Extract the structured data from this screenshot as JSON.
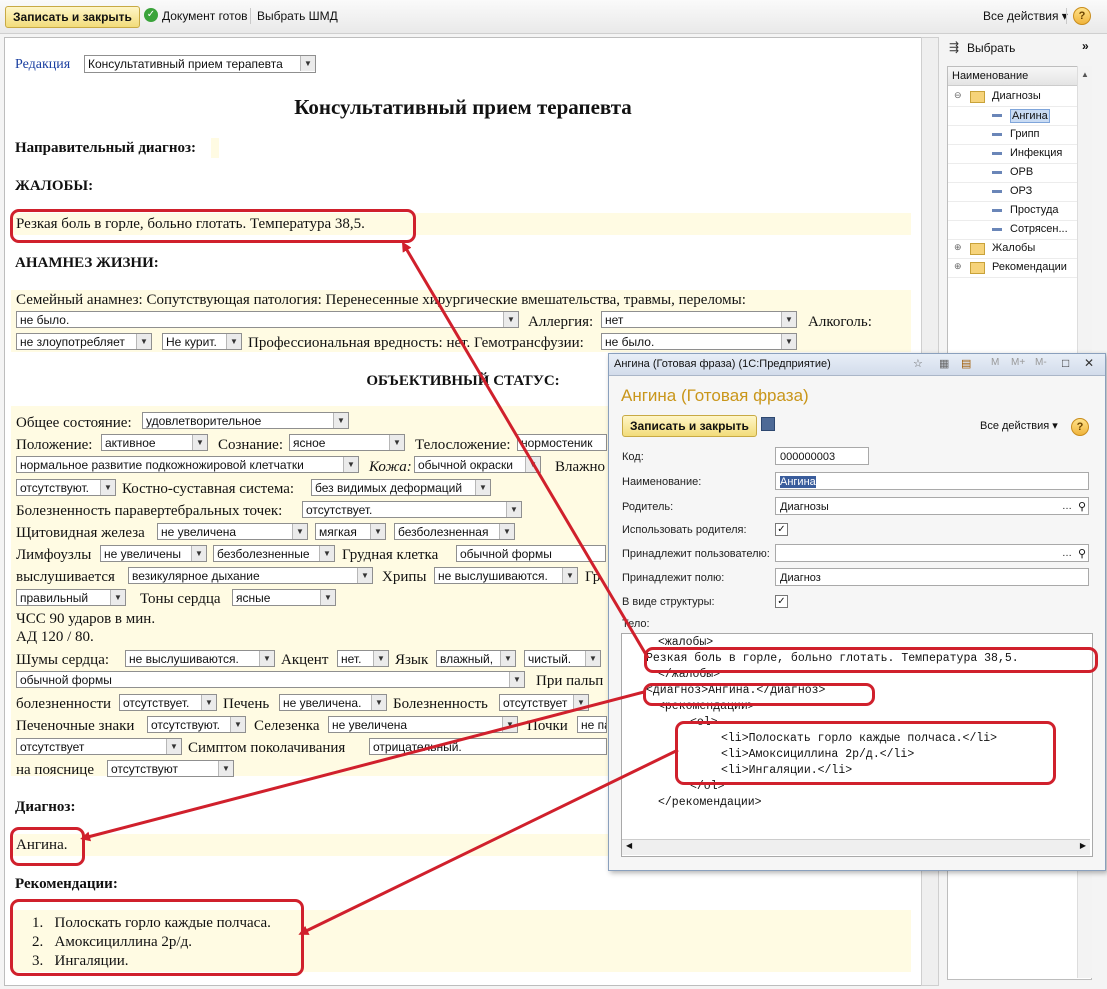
{
  "toolbar": {
    "save_close": "Записать и закрыть",
    "doc_ready": "Документ готов",
    "choose_template": "Выбрать ШМД",
    "all_actions": "Все действия",
    "help": "?"
  },
  "document": {
    "edition_label": "Редакция",
    "edition_value": "Консультативный прием терапевта",
    "title": "Консультативный прием терапевта",
    "referral_diagnosis": "Направительный диагноз:",
    "complaints_heading": "ЖАЛОБЫ:",
    "complaints_text": "Резкая боль в горле, больно глотать. Температура 38,5.",
    "anamnesis_heading": "АНАМНЕЗ ЖИЗНИ:",
    "anamnesis_line1": "Семейный анамнез:  Сопутствующая патология:   Перенесенные хирургические вмешательства, травмы, переломы:",
    "hist_value": "не было.",
    "allergy_label": "Аллергия:",
    "allergy_value": "нет",
    "alcohol_label": "Алкоголь:",
    "alcohol_value": "не злоупотребляет",
    "smoking_value": "Не курит.",
    "prof_label": "Профессиональная вредность: нет. Гемотрансфузии:",
    "transfusion_value": "не было.",
    "objective_heading": "ОБЪЕКТИВНЫЙ СТАТУС:",
    "general_label": "Общее состояние:",
    "general_value": "удовлетворительное",
    "position_label": "Положение:",
    "position_value": "активное",
    "consciousness_label": "Сознание:",
    "consciousness_value": "ясное",
    "build_label": "Телосложение:",
    "build_value": "нормостеник",
    "fat_value": "нормальное развитие подкожножировой клетчатки",
    "skin_label": "Кожа:",
    "skin_value": "обычной окраски",
    "moist_label": "Влажно",
    "absent_value": "отсутствуют.",
    "bones_label": "Костно-суставная система:",
    "bones_value": "без видимых деформаций",
    "paravert_label": "Болезненность паравертебральных точек:",
    "paravert_value": "отсутствует.",
    "thyroid_label": "Щитовидная железа",
    "thyroid_value1": "не увеличена",
    "thyroid_value2": "мягкая",
    "thyroid_value3": "безболезненная",
    "lymph_label": "Лимфоузлы",
    "lymph_value1": "не увеличены",
    "lymph_value2": "безболезненные",
    "chest_label": "Грудная клетка",
    "chest_value": "обычной формы",
    "auscult_label": "выслушивается",
    "breathing_value": "везикулярное дыхание",
    "rales_label": "Хрипы",
    "rales_value": "не выслушиваются.",
    "gr_label": "Гр",
    "rhythm_value": "правильный",
    "tones_label": "Тоны сердца",
    "tones_value": "ясные",
    "hr_text": "ЧСС 90 ударов в мин.",
    "bp_text": "АД 120 / 80.",
    "murmurs_label": "Шумы сердца:",
    "murmurs_value": "не выслушиваются.",
    "accent_label": "Акцент",
    "accent_value": "нет.",
    "tongue_label": "Язык",
    "tongue_value1": "влажный,",
    "tongue_value2": "чистый.",
    "belly_form_value": "обычной формы",
    "palp_label": "При пальп",
    "pain_label": "болезненности",
    "pain_value": "отсутствует.",
    "liver_label": "Печень",
    "liver_value": "не увеличена.",
    "pain2_label": "Болезненность",
    "pain2_value": "отсутствует",
    "liver_signs_label": "Печеночные знаки",
    "liver_signs_value": "отсутствуют.",
    "spleen_label": "Селезенка",
    "spleen_value": "не увеличена",
    "kidney_label": "Почки",
    "kidney_value": "не па",
    "tapping_pre_value": "отсутствует",
    "tapping_label": "Симптом поколачивания",
    "tapping_value": "отрицательный.",
    "lumbar_label": "на пояснице",
    "lumbar_value": "отсутствуют",
    "diagnosis_heading": "Диагноз:",
    "diagnosis_text": "Ангина.",
    "recommendations_heading": "Рекомендации:",
    "recommendations": [
      "Полоскать горло каждые полчаса.",
      "Амоксициллина 2р/д.",
      "Ингаляции."
    ]
  },
  "tree": {
    "choose": "Выбрать",
    "column": "Наименование",
    "items": [
      {
        "label": "Диагнозы",
        "level": 0,
        "icon": "folder-open"
      },
      {
        "label": "Ангина",
        "level": 1,
        "icon": "item",
        "selected": true
      },
      {
        "label": "Грипп",
        "level": 1,
        "icon": "item"
      },
      {
        "label": "Инфекция",
        "level": 1,
        "icon": "item"
      },
      {
        "label": "ОРВ",
        "level": 1,
        "icon": "item"
      },
      {
        "label": "ОРЗ",
        "level": 1,
        "icon": "item"
      },
      {
        "label": "Простуда",
        "level": 1,
        "icon": "item"
      },
      {
        "label": "Сотрясен...",
        "level": 1,
        "icon": "item"
      },
      {
        "label": "Жалобы",
        "level": 0,
        "icon": "folder"
      },
      {
        "label": "Рекомендации",
        "level": 0,
        "icon": "folder"
      }
    ]
  },
  "popup": {
    "window_title": "Ангина (Готовая фраза)  (1С:Предприятие)",
    "heading": "Ангина (Готовая фраза)",
    "save_close": "Записать и закрыть",
    "all_actions": "Все действия",
    "code_label": "Код:",
    "code_value": "000000003",
    "name_label": "Наименование:",
    "name_value": "Ангина",
    "parent_label": "Родитель:",
    "parent_value": "Диагнозы",
    "use_parent_label": "Использовать родителя:",
    "belongs_user_label": "Принадлежит пользователю:",
    "belongs_user_value": "",
    "belongs_field_label": "Принадлежит полю:",
    "belongs_field_value": "Диагноз",
    "structure_label": "В виде структуры:",
    "body_label": "Тело:",
    "body_lines": [
      "<жалобы>",
      "Резкая боль в горле, больно глотать. Температура 38,5.",
      "</жалобы>",
      "<диагноз>Ангина.</диагноз>",
      "<рекомендации>",
      "<ol>",
      "<li>Полоскать горло каждые полчаса.</li>",
      "<li>Амоксициллина 2р/д.</li>",
      "<li>Ингаляции.</li>",
      "</ol>",
      "</рекомендации>"
    ]
  },
  "colors": {
    "annotation_red": "#d0202c",
    "highlight_yellow": "#fffbe3",
    "link_blue": "#1a3fa0",
    "popup_heading": "#c9961a"
  }
}
